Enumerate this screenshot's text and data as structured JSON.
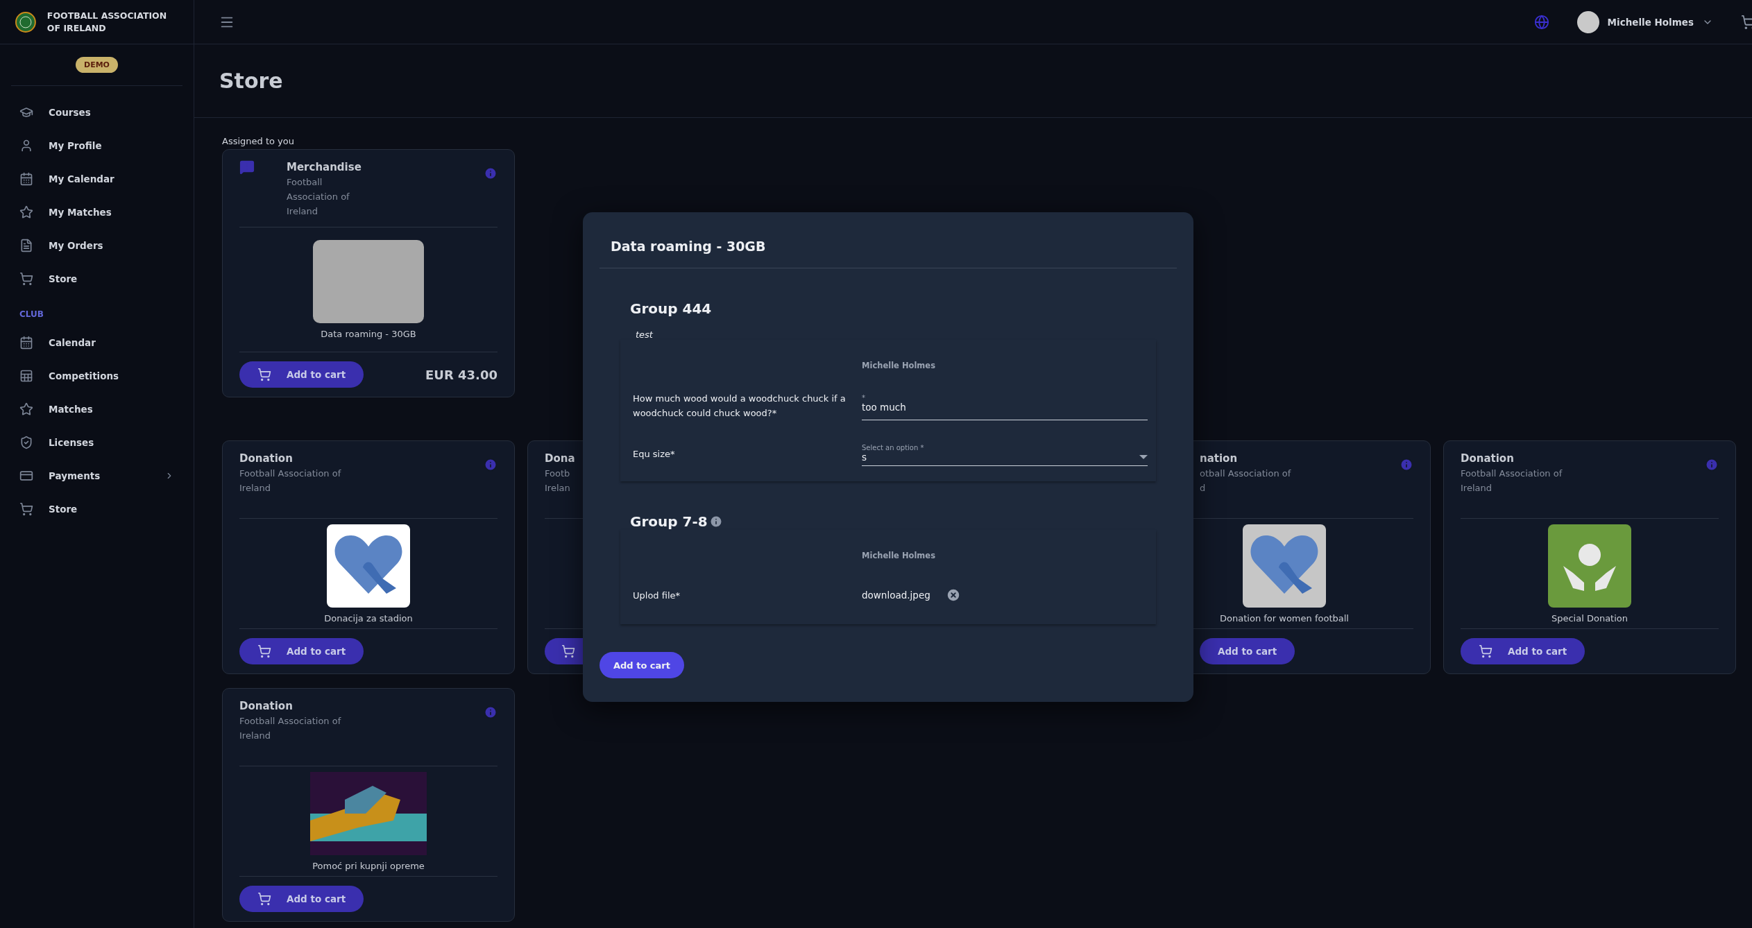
{
  "sidebar": {
    "brand": "FOOTBALL ASSOCIATION OF IRELAND",
    "badge": "DEMO",
    "sections": [
      {
        "items": [
          {
            "label": "Courses",
            "expandable": false
          },
          {
            "label": "My Profile",
            "expandable": false
          },
          {
            "label": "My Calendar",
            "expandable": false
          },
          {
            "label": "My Matches",
            "expandable": false
          },
          {
            "label": "My Orders",
            "expandable": false
          },
          {
            "label": "Store",
            "expandable": false
          }
        ]
      },
      {
        "label": "CLUB",
        "items": [
          {
            "label": "Calendar",
            "expandable": false
          },
          {
            "label": "Competitions",
            "expandable": false
          },
          {
            "label": "Matches",
            "expandable": false
          },
          {
            "label": "Licenses",
            "expandable": false
          },
          {
            "label": "Payments",
            "expandable": true
          },
          {
            "label": "Store",
            "expandable": false
          }
        ]
      }
    ]
  },
  "topbar": {
    "user": {
      "name": "Michelle Holmes"
    }
  },
  "page": {
    "title": "Store",
    "assigned_label": "Assigned to you",
    "assigned": [
      {
        "kind": "full",
        "title": "Merchandise",
        "subtitle": [
          "Football",
          "Association of",
          "Ireland"
        ],
        "flagged": true,
        "image": {
          "kind": "phone"
        },
        "caption": "Data roaming - 30GB",
        "button": "Add to cart",
        "price": "EUR 43.00"
      }
    ],
    "cards": [
      {
        "kind": "full",
        "title": "Donation",
        "subtitle": [
          "Football Association of",
          "Ireland"
        ],
        "flagged": false,
        "image": {
          "kind": "donate"
        },
        "caption": "Donacija za stadion",
        "button": "Add to cart"
      },
      {
        "kind": "cut-right",
        "title": "Dona",
        "subtitle": [
          "Footb",
          "Irelan"
        ],
        "flagged": false
      },
      {
        "kind": "cut-left",
        "title": "nation",
        "subtitle": [
          "otball Association of",
          "d"
        ],
        "flagged": false,
        "image": {
          "kind": "donate-grey"
        },
        "caption": "Donation for women football",
        "button": "Add to cart"
      },
      {
        "kind": "full",
        "title": "Donation",
        "subtitle": [
          "Football Association of",
          "Ireland"
        ],
        "flagged": false,
        "image": {
          "kind": "hands"
        },
        "caption": "Special Donation",
        "button": "Add to cart"
      },
      {
        "kind": "full",
        "title": "Donation",
        "subtitle": [
          "Football Association of",
          "Ireland"
        ],
        "flagged": false,
        "image": {
          "kind": "handshake"
        },
        "caption": "Pomoć pri kupnji opreme",
        "button": "Add to cart"
      }
    ]
  },
  "modal": {
    "title": "Data roaming - 30GB",
    "groups": [
      {
        "title": "Group 444",
        "description": "test",
        "info": false,
        "owner": "Michelle Holmes",
        "fields": [
          {
            "kind": "text",
            "label": "How much wood would a woodchuck chuck if a woodchuck could chuck wood?*",
            "floating_label": "*",
            "value": "too much"
          },
          {
            "kind": "select",
            "label": "Equ size*",
            "floating_label": "Select an option *",
            "value": "s"
          }
        ]
      },
      {
        "title": "Group 7-8",
        "info": true,
        "owner": "Michelle Holmes",
        "fields": [
          {
            "kind": "file",
            "label": "Uplod file*",
            "value": "download.jpeg"
          }
        ]
      }
    ],
    "button": "Add to cart"
  }
}
